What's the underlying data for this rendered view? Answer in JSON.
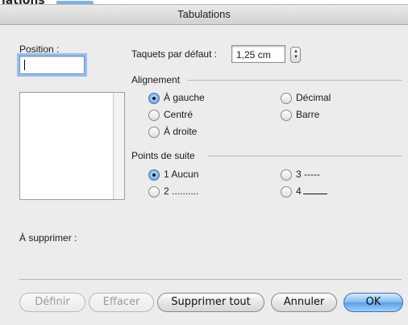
{
  "behind": {
    "text": "lations"
  },
  "window": {
    "title": "Tabulations"
  },
  "position": {
    "label": "Position :",
    "value": ""
  },
  "default_tabs": {
    "label": "Taquets par défaut :",
    "value": "1,25 cm"
  },
  "alignment": {
    "title": "Alignement",
    "options": [
      "À gauche",
      "Centré",
      "À droite",
      "Décimal",
      "Barre"
    ],
    "selected": "À gauche"
  },
  "leader": {
    "title": "Points de suite",
    "options": [
      "1 Aucun",
      "2 ..........",
      "3 -----",
      "4"
    ],
    "selected": "1 Aucun"
  },
  "to_delete": {
    "label": "À supprimer :"
  },
  "buttons": {
    "define": "Définir",
    "clear": "Effacer",
    "delete_all": "Supprimer tout",
    "cancel": "Annuler",
    "ok": "OK"
  },
  "icons": {
    "stepper": "stepper-arrows-icon"
  },
  "colors": {
    "default_button": "#5aa0e6",
    "focus_ring": "#97bfe9"
  }
}
